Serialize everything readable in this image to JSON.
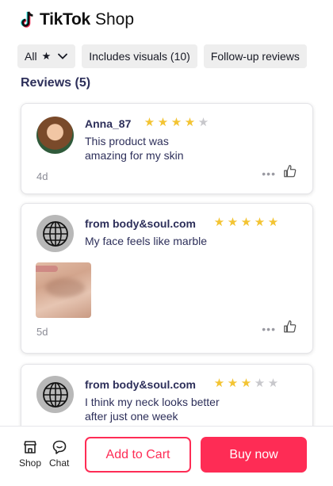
{
  "brand": {
    "name": "TikTok",
    "suffix": "Shop"
  },
  "filters": {
    "all_label": "All",
    "visuals_label": "Includes visuals (10)",
    "followup_label": "Follow-up reviews"
  },
  "reviews_title": "Reviews (5)",
  "reviews": [
    {
      "author": "Anna_87",
      "rating": 4,
      "text": "This product was amazing for my skin",
      "age": "4d",
      "avatar": "user-photo"
    },
    {
      "author": "from body&soul.com",
      "rating": 5,
      "text": "My face feels like marble",
      "age": "5d",
      "avatar": "globe-icon",
      "has_photo": true
    },
    {
      "author": "from body&soul.com",
      "rating": 3,
      "text": "I think my neck looks better after just one week",
      "avatar": "globe-icon"
    }
  ],
  "bottom_bar": {
    "shop_label": "Shop",
    "chat_label": "Chat",
    "add_to_cart_label": "Add to Cart",
    "buy_now_label": "Buy now"
  },
  "colors": {
    "accent": "#fe2c55",
    "star": "#f3c433",
    "star_off": "#c8c8cc",
    "text": "#2d2f5a"
  }
}
